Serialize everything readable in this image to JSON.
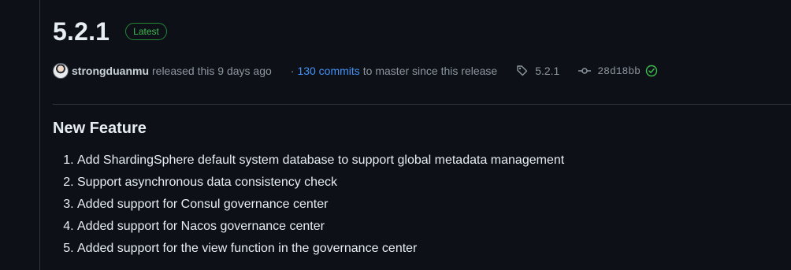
{
  "release": {
    "version": "5.2.1",
    "badge": "Latest"
  },
  "meta": {
    "author": "strongduanmu",
    "released_text": "released this 9 days ago",
    "separator": "·",
    "commits_link": "130 commits",
    "commits_suffix": "to master since this release",
    "tag": "5.2.1",
    "commit_hash": "28d18bb",
    "verified_icon": "check-circle-icon"
  },
  "section": {
    "heading": "New Feature",
    "items": [
      "Add ShardingSphere default system database to support global metadata management",
      "Support asynchronous data consistency check",
      "Added support for Consul governance center",
      "Added support for Nacos governance center",
      "Added support for the view function in the governance center"
    ]
  },
  "colors": {
    "background": "#0d1117",
    "text": "#e6edf3",
    "muted": "#8d96a0",
    "link": "#4493f8",
    "success": "#3fb950",
    "border": "#30363d"
  }
}
